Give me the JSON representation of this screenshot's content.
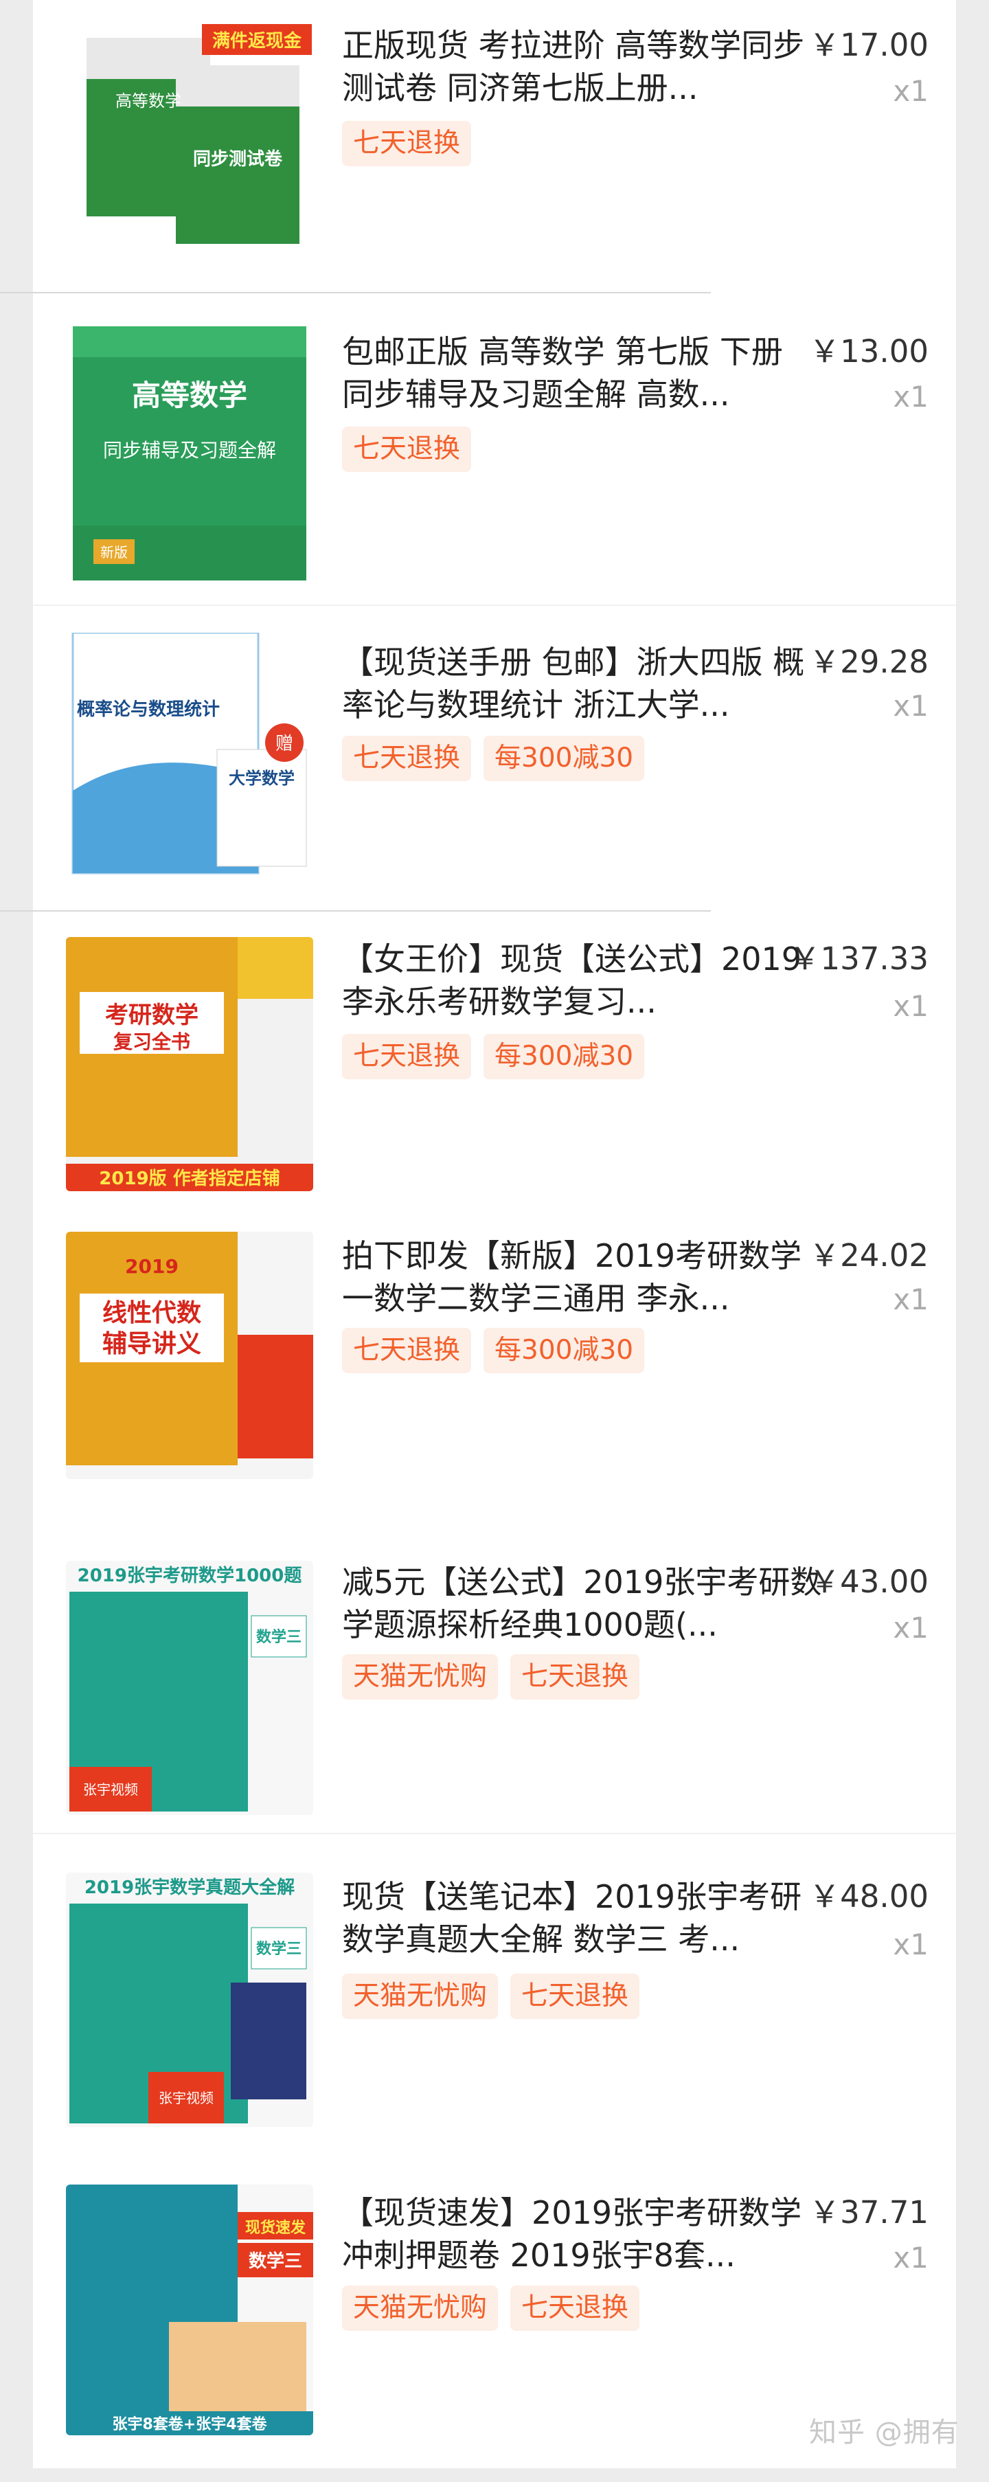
{
  "orders": [
    {
      "title": "正版现货 考拉进阶 高等数学同步测试卷 同济第七版上册...",
      "price": "￥17.00",
      "qty": "x1",
      "tags": [
        "七天退换"
      ],
      "cover": {
        "label1": "满件返现金",
        "label2": "高等数学",
        "label3": "同步测试卷"
      }
    },
    {
      "title": "包邮正版 高等数学 第七版 下册 同步辅导及习题全解 高数...",
      "price": "￥13.00",
      "qty": "x1",
      "tags": [
        "七天退换"
      ],
      "cover": {
        "label1": "高等数学",
        "label2": "同步辅导及习题全解",
        "label3": "新版"
      }
    },
    {
      "title": "【现货送手册 包邮】浙大四版 概率论与数理统计 浙江大学...",
      "price": "￥29.28",
      "qty": "x1",
      "tags": [
        "七天退换",
        "每300减30"
      ],
      "cover": {
        "label1": "概率论与数理统计",
        "label2": "大学数学",
        "label3": "赠"
      }
    },
    {
      "title": "【女王价】现货【送公式】2019李永乐考研数学复习...",
      "price": "￥137.33",
      "qty": "x1",
      "tags": [
        "七天退换",
        "每300减30"
      ],
      "cover": {
        "label1": "考研数学",
        "label2": "复习全书",
        "label3": "2019版 作者指定店铺"
      }
    },
    {
      "title": "拍下即发【新版】2019考研数学一数学二数学三通用 李永...",
      "price": "￥24.02",
      "qty": "x1",
      "tags": [
        "七天退换",
        "每300减30"
      ],
      "cover": {
        "label1": "线性代数",
        "label2": "辅导讲义",
        "label3": "2019"
      }
    },
    {
      "title": "减5元【送公式】2019张宇考研数学题源探析经典1000题(...",
      "price": "￥43.00",
      "qty": "x1",
      "tags": [
        "天猫无忧购",
        "七天退换"
      ],
      "cover": {
        "label1": "2019张宇考研数学1000题",
        "label2": "数学三",
        "label3": "张宇视频"
      }
    },
    {
      "title": "现货【送笔记本】2019张宇考研数学真题大全解 数学三 考...",
      "price": "￥48.00",
      "qty": "x1",
      "tags": [
        "天猫无忧购",
        "七天退换"
      ],
      "cover": {
        "label1": "2019张宇数学真题大全解",
        "label2": "数学三",
        "label3": "张宇视频"
      }
    },
    {
      "title": "【现货速发】2019张宇考研数学冲刺押题卷 2019张宇8套...",
      "price": "￥37.71",
      "qty": "x1",
      "tags": [
        "天猫无忧购",
        "七天退换"
      ],
      "cover": {
        "label1": "现货速发",
        "label2": "数学三",
        "label3": "张宇8套卷+张宇4套卷"
      }
    }
  ],
  "watermark": "知乎 @拥有",
  "colors": {
    "tag_bg": "#fdeee6",
    "tag_text": "#f2612c",
    "price": "#333333"
  }
}
